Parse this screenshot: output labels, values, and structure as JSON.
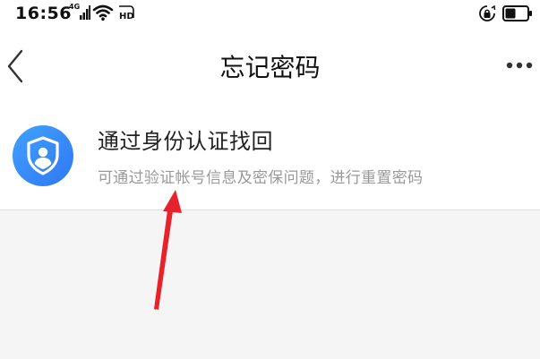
{
  "status_bar": {
    "time": "16:56",
    "network": "4G",
    "hd_label": "HD",
    "icons": [
      "signal-icon",
      "wifi-icon",
      "hd-icon",
      "rotation-lock-icon",
      "battery-icon"
    ]
  },
  "nav": {
    "title": "忘记密码",
    "back_icon": "chevron-left-icon",
    "more_icon": "more-horizontal-icon"
  },
  "option": {
    "icon": "shield-user-icon",
    "title": "通过身份认证找回",
    "description": "可通过验证帐号信息及密保问题，进行重置密码"
  },
  "annotation": {
    "icon": "red-arrow-icon",
    "color": "#e8222b"
  },
  "colors": {
    "badge_gradient_start": "#41a2ff",
    "badge_gradient_end": "#2f77f2",
    "background": "#f5f5f5"
  }
}
